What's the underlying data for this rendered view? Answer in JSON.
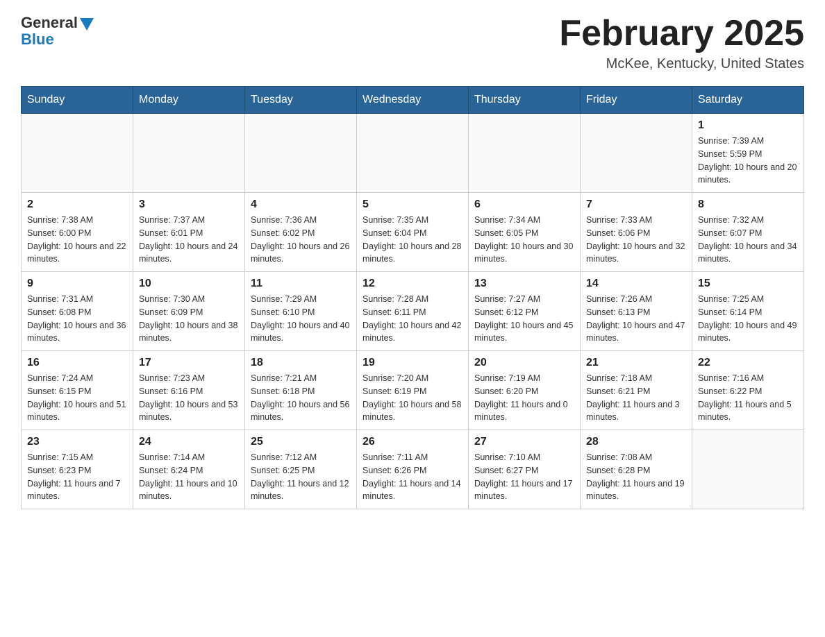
{
  "header": {
    "logo_general": "General",
    "logo_blue": "Blue",
    "month_title": "February 2025",
    "location": "McKee, Kentucky, United States"
  },
  "weekdays": [
    "Sunday",
    "Monday",
    "Tuesday",
    "Wednesday",
    "Thursday",
    "Friday",
    "Saturday"
  ],
  "weeks": [
    [
      {
        "day": "",
        "info": ""
      },
      {
        "day": "",
        "info": ""
      },
      {
        "day": "",
        "info": ""
      },
      {
        "day": "",
        "info": ""
      },
      {
        "day": "",
        "info": ""
      },
      {
        "day": "",
        "info": ""
      },
      {
        "day": "1",
        "info": "Sunrise: 7:39 AM\nSunset: 5:59 PM\nDaylight: 10 hours and 20 minutes."
      }
    ],
    [
      {
        "day": "2",
        "info": "Sunrise: 7:38 AM\nSunset: 6:00 PM\nDaylight: 10 hours and 22 minutes."
      },
      {
        "day": "3",
        "info": "Sunrise: 7:37 AM\nSunset: 6:01 PM\nDaylight: 10 hours and 24 minutes."
      },
      {
        "day": "4",
        "info": "Sunrise: 7:36 AM\nSunset: 6:02 PM\nDaylight: 10 hours and 26 minutes."
      },
      {
        "day": "5",
        "info": "Sunrise: 7:35 AM\nSunset: 6:04 PM\nDaylight: 10 hours and 28 minutes."
      },
      {
        "day": "6",
        "info": "Sunrise: 7:34 AM\nSunset: 6:05 PM\nDaylight: 10 hours and 30 minutes."
      },
      {
        "day": "7",
        "info": "Sunrise: 7:33 AM\nSunset: 6:06 PM\nDaylight: 10 hours and 32 minutes."
      },
      {
        "day": "8",
        "info": "Sunrise: 7:32 AM\nSunset: 6:07 PM\nDaylight: 10 hours and 34 minutes."
      }
    ],
    [
      {
        "day": "9",
        "info": "Sunrise: 7:31 AM\nSunset: 6:08 PM\nDaylight: 10 hours and 36 minutes."
      },
      {
        "day": "10",
        "info": "Sunrise: 7:30 AM\nSunset: 6:09 PM\nDaylight: 10 hours and 38 minutes."
      },
      {
        "day": "11",
        "info": "Sunrise: 7:29 AM\nSunset: 6:10 PM\nDaylight: 10 hours and 40 minutes."
      },
      {
        "day": "12",
        "info": "Sunrise: 7:28 AM\nSunset: 6:11 PM\nDaylight: 10 hours and 42 minutes."
      },
      {
        "day": "13",
        "info": "Sunrise: 7:27 AM\nSunset: 6:12 PM\nDaylight: 10 hours and 45 minutes."
      },
      {
        "day": "14",
        "info": "Sunrise: 7:26 AM\nSunset: 6:13 PM\nDaylight: 10 hours and 47 minutes."
      },
      {
        "day": "15",
        "info": "Sunrise: 7:25 AM\nSunset: 6:14 PM\nDaylight: 10 hours and 49 minutes."
      }
    ],
    [
      {
        "day": "16",
        "info": "Sunrise: 7:24 AM\nSunset: 6:15 PM\nDaylight: 10 hours and 51 minutes."
      },
      {
        "day": "17",
        "info": "Sunrise: 7:23 AM\nSunset: 6:16 PM\nDaylight: 10 hours and 53 minutes."
      },
      {
        "day": "18",
        "info": "Sunrise: 7:21 AM\nSunset: 6:18 PM\nDaylight: 10 hours and 56 minutes."
      },
      {
        "day": "19",
        "info": "Sunrise: 7:20 AM\nSunset: 6:19 PM\nDaylight: 10 hours and 58 minutes."
      },
      {
        "day": "20",
        "info": "Sunrise: 7:19 AM\nSunset: 6:20 PM\nDaylight: 11 hours and 0 minutes."
      },
      {
        "day": "21",
        "info": "Sunrise: 7:18 AM\nSunset: 6:21 PM\nDaylight: 11 hours and 3 minutes."
      },
      {
        "day": "22",
        "info": "Sunrise: 7:16 AM\nSunset: 6:22 PM\nDaylight: 11 hours and 5 minutes."
      }
    ],
    [
      {
        "day": "23",
        "info": "Sunrise: 7:15 AM\nSunset: 6:23 PM\nDaylight: 11 hours and 7 minutes."
      },
      {
        "day": "24",
        "info": "Sunrise: 7:14 AM\nSunset: 6:24 PM\nDaylight: 11 hours and 10 minutes."
      },
      {
        "day": "25",
        "info": "Sunrise: 7:12 AM\nSunset: 6:25 PM\nDaylight: 11 hours and 12 minutes."
      },
      {
        "day": "26",
        "info": "Sunrise: 7:11 AM\nSunset: 6:26 PM\nDaylight: 11 hours and 14 minutes."
      },
      {
        "day": "27",
        "info": "Sunrise: 7:10 AM\nSunset: 6:27 PM\nDaylight: 11 hours and 17 minutes."
      },
      {
        "day": "28",
        "info": "Sunrise: 7:08 AM\nSunset: 6:28 PM\nDaylight: 11 hours and 19 minutes."
      },
      {
        "day": "",
        "info": ""
      }
    ]
  ]
}
